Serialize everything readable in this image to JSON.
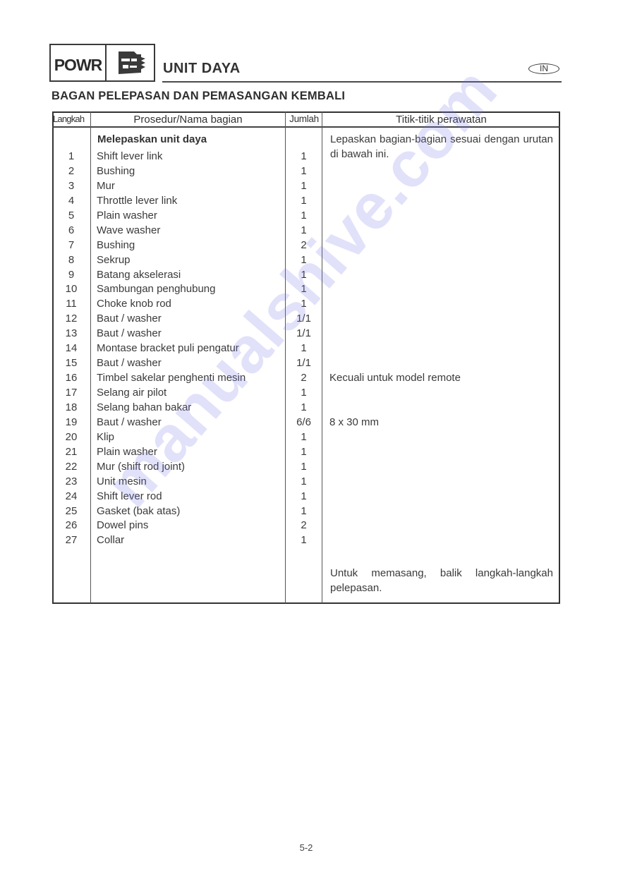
{
  "header": {
    "section_code": "POWR",
    "section_icon": "power-unit-icon",
    "title": "UNIT DAYA",
    "language_badge": "IN"
  },
  "subtitle": "BAGAN PELEPASAN DAN PEMASANGAN KEMBALI",
  "table": {
    "columns": [
      "Langkah",
      "Prosedur/Nama bagian",
      "Jumlah",
      "Titik-titik perawatan"
    ],
    "section_heading": "Melepaskan unit daya",
    "intro_note": "Lepaskan bagian-bagian sesuai dengan urutan di bawah ini.",
    "rows": [
      {
        "step": "1",
        "part": "Shift lever link",
        "qty": "1",
        "note": ""
      },
      {
        "step": "2",
        "part": "Bushing",
        "qty": "1",
        "note": ""
      },
      {
        "step": "3",
        "part": "Mur",
        "qty": "1",
        "note": ""
      },
      {
        "step": "4",
        "part": "Throttle lever link",
        "qty": "1",
        "note": ""
      },
      {
        "step": "5",
        "part": "Plain washer",
        "qty": "1",
        "note": ""
      },
      {
        "step": "6",
        "part": "Wave washer",
        "qty": "1",
        "note": ""
      },
      {
        "step": "7",
        "part": "Bushing",
        "qty": "2",
        "note": ""
      },
      {
        "step": "8",
        "part": "Sekrup",
        "qty": "1",
        "note": ""
      },
      {
        "step": "9",
        "part": "Batang akselerasi",
        "qty": "1",
        "note": ""
      },
      {
        "step": "10",
        "part": "Sambungan penghubung",
        "qty": "1",
        "note": ""
      },
      {
        "step": "11",
        "part": "Choke knob rod",
        "qty": "1",
        "note": ""
      },
      {
        "step": "12",
        "part": "Baut / washer",
        "qty": "1/1",
        "note": ""
      },
      {
        "step": "13",
        "part": "Baut / washer",
        "qty": "1/1",
        "note": ""
      },
      {
        "step": "14",
        "part": "Montase bracket puli pengatur",
        "qty": "1",
        "note": ""
      },
      {
        "step": "15",
        "part": "Baut / washer",
        "qty": "1/1",
        "note": ""
      },
      {
        "step": "16",
        "part": "Timbel sakelar penghenti mesin",
        "qty": "2",
        "note": "Kecuali untuk model remote"
      },
      {
        "step": "17",
        "part": "Selang air pilot",
        "qty": "1",
        "note": ""
      },
      {
        "step": "18",
        "part": "Selang bahan bakar",
        "qty": "1",
        "note": ""
      },
      {
        "step": "19",
        "part": "Baut / washer",
        "qty": "6/6",
        "note": "8 x 30 mm"
      },
      {
        "step": "20",
        "part": "Klip",
        "qty": "1",
        "note": ""
      },
      {
        "step": "21",
        "part": "Plain washer",
        "qty": "1",
        "note": ""
      },
      {
        "step": "22",
        "part": "Mur (shift rod joint)",
        "qty": "1",
        "note": ""
      },
      {
        "step": "23",
        "part": "Unit mesin",
        "qty": "1",
        "note": ""
      },
      {
        "step": "24",
        "part": "Shift lever rod",
        "qty": "1",
        "note": ""
      },
      {
        "step": "25",
        "part": "Gasket (bak atas)",
        "qty": "1",
        "note": ""
      },
      {
        "step": "26",
        "part": "Dowel pins",
        "qty": "2",
        "note": ""
      },
      {
        "step": "27",
        "part": "Collar",
        "qty": "1",
        "note": ""
      }
    ],
    "closing_note": "Untuk memasang, balik langkah-langkah pelepasan."
  },
  "page_number": "5-2",
  "watermark": "manualshive.com"
}
